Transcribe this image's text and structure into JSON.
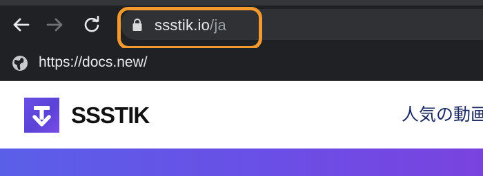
{
  "browser": {
    "address_bar": {
      "host": "ssstik.io",
      "path": "/ja"
    },
    "bookmarks": [
      {
        "label": "https://docs.new/",
        "icon": "globe-icon"
      }
    ],
    "highlight_color": "#f3992e"
  },
  "site": {
    "brand": "SSSTIK",
    "nav_text": "人気の動画",
    "accent_color": "#6a4ee6"
  }
}
